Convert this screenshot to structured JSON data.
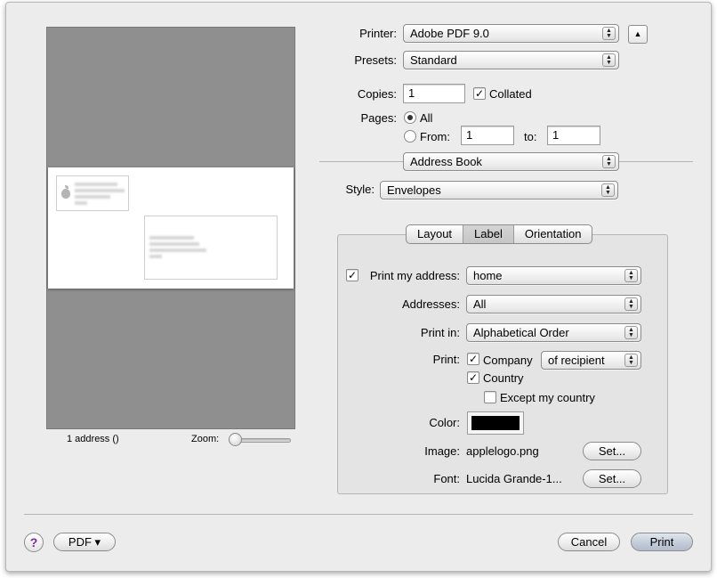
{
  "preview": {
    "address_count": "1 address ()",
    "zoom_label": "Zoom:",
    "zoom_level_fraction": 0.0
  },
  "printer": {
    "label": "Printer:",
    "value": "Adobe PDF 9.0",
    "disclosure_icon": "triangle-up"
  },
  "presets": {
    "label": "Presets:",
    "value": "Standard"
  },
  "copies": {
    "label": "Copies:",
    "value": "1",
    "collated_label": "Collated",
    "collated_checked": true
  },
  "pages": {
    "label": "Pages:",
    "all_label": "All",
    "from_label": "From:",
    "from_value": "1",
    "to_label": "to:",
    "to_value": "1"
  },
  "panel": {
    "value": "Address Book"
  },
  "style": {
    "label": "Style:",
    "value": "Envelopes"
  },
  "tabs": [
    {
      "label": "Layout"
    },
    {
      "label": "Label"
    },
    {
      "label": "Orientation"
    }
  ],
  "label_tab": {
    "print_my_address_label": "Print my address:",
    "print_my_address_value": "home",
    "addresses_label": "Addresses:",
    "addresses_value": "All",
    "print_in_label": "Print in:",
    "print_in_value": "Alphabetical Order",
    "print_label": "Print:",
    "company_label": "Company",
    "company_of_value": "of recipient",
    "country_label": "Country",
    "except_label": "Except my country",
    "color_label": "Color:",
    "color_value": "#000000",
    "image_label": "Image:",
    "image_value": "applelogo.png",
    "image_set": "Set...",
    "font_label": "Font:",
    "font_value": "Lucida Grande-1...",
    "font_set": "Set..."
  },
  "footer": {
    "help_label": "?",
    "pdf_label": "PDF ▾",
    "cancel_label": "Cancel",
    "print_label": "Print"
  }
}
